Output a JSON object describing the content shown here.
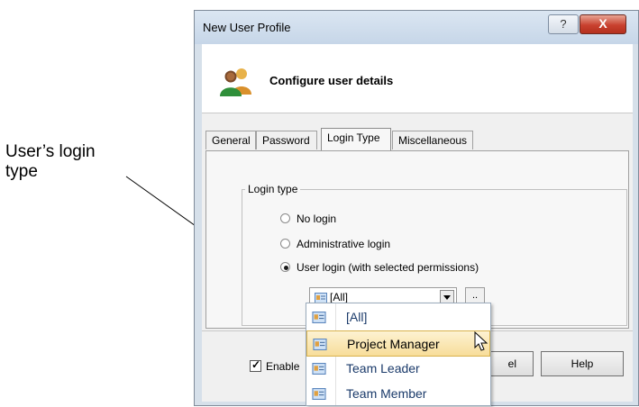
{
  "callout": {
    "line1": "User’s login",
    "line2": "type"
  },
  "window": {
    "title": "New User Profile",
    "help_glyph": "?",
    "close_glyph": "X"
  },
  "header": {
    "title": "Configure user details"
  },
  "tabs": [
    {
      "label": "General"
    },
    {
      "label": "Password"
    },
    {
      "label": "Login Type"
    },
    {
      "label": "Miscellaneous"
    }
  ],
  "login_group": {
    "label": "Login type",
    "options": [
      {
        "label": "No login",
        "selected": false
      },
      {
        "label": "Administrative login",
        "selected": false
      },
      {
        "label": "User login (with selected permissions)",
        "selected": true
      }
    ]
  },
  "permissions_combo": {
    "value": "[All]",
    "ellipsis_label": ".."
  },
  "dropdown": {
    "items": [
      {
        "label": "[All]"
      },
      {
        "label": "Project Manager"
      },
      {
        "label": "Team Leader"
      },
      {
        "label": "Team Member"
      }
    ],
    "hovered_index": 1
  },
  "footer": {
    "enable_label": "Enable",
    "enable_checked": true,
    "cancel_label": "el",
    "help_label": "Help"
  },
  "colors": {
    "highlight": "#f7dd9a",
    "close_button": "#c8412f",
    "item_text": "#1a3a6a"
  },
  "icons": [
    "user-group-icon",
    "permission-icon",
    "pointer-cursor-icon"
  ]
}
